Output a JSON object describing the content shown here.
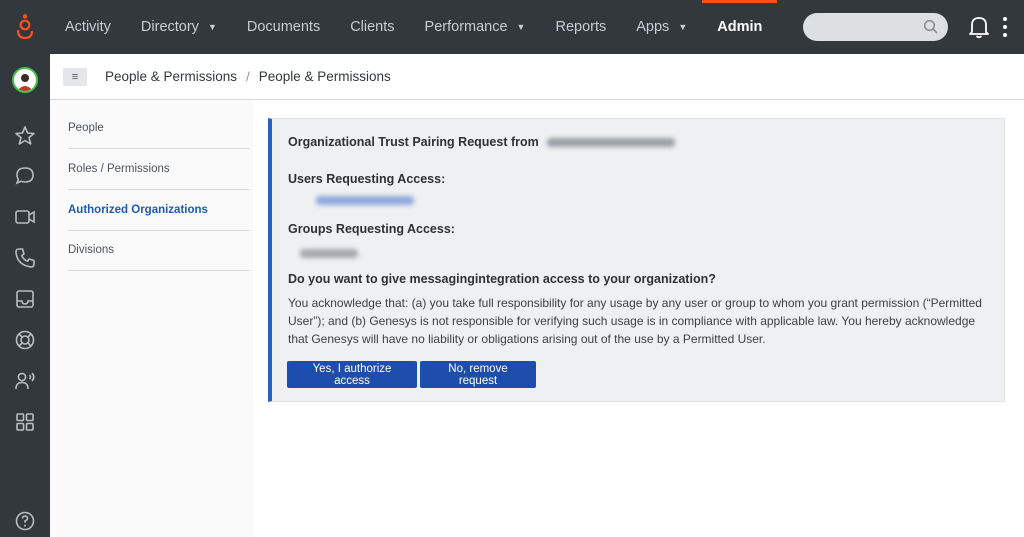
{
  "topnav": {
    "items": [
      {
        "label": "Activity",
        "caret": false
      },
      {
        "label": "Directory",
        "caret": true
      },
      {
        "label": "Documents",
        "caret": false
      },
      {
        "label": "Clients",
        "caret": false
      },
      {
        "label": "Performance",
        "caret": true
      },
      {
        "label": "Reports",
        "caret": false
      },
      {
        "label": "Apps",
        "caret": true
      },
      {
        "label": "Admin",
        "caret": false,
        "active": true
      }
    ],
    "search_placeholder": "",
    "accent_color": "#ff4f1f"
  },
  "rail": {
    "icons": [
      "avatar",
      "star-icon",
      "chat-icon",
      "video-icon",
      "phone-icon",
      "inbox-icon",
      "help-ring-icon",
      "people-voice-icon",
      "apps-grid-icon",
      "question-icon"
    ]
  },
  "breadcrumb": {
    "parent": "People & Permissions",
    "separator": "/",
    "current": "People & Permissions"
  },
  "sidenav": {
    "items": [
      {
        "label": "People"
      },
      {
        "label": "Roles / Permissions"
      },
      {
        "label": "Authorized Organizations",
        "active": true
      },
      {
        "label": "Divisions"
      }
    ]
  },
  "request": {
    "title": "Organizational Trust Pairing Request from",
    "users_label": "Users Requesting Access:",
    "groups_label": "Groups Requesting Access:",
    "question": "Do you want to give messagingintegration access to your organization?",
    "acknowledgement": "You acknowledge that: (a) you take full responsibility for any usage by any user or group to whom you grant permission (“Permitted User”); and (b) Genesys is not responsible for verifying such usage is in compliance with applicable law. You hereby acknowledge that Genesys will have no liability or obligations arising out of the use by a Permitted User.",
    "authorize_button": "Yes, I authorize access",
    "remove_button": "No, remove request",
    "button_color": "#1e4ead",
    "border_color": "#2a60c4"
  }
}
